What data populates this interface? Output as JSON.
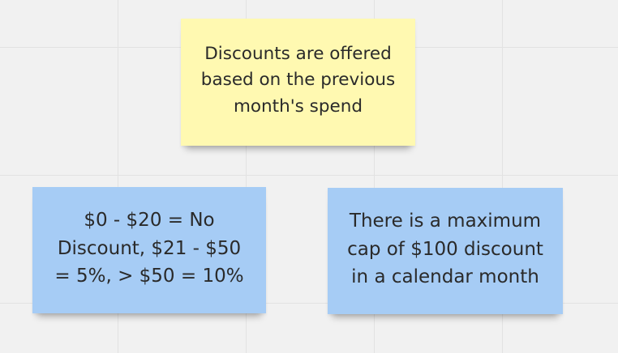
{
  "board": {
    "colors": {
      "background": "#f1f1f1",
      "grid_line": "#e2e2e2",
      "sticky_yellow": "#fff9b1",
      "sticky_blue": "#a6ccf5",
      "text": "#2a2a2a"
    }
  },
  "stickies": {
    "top": {
      "color": "yellow",
      "text": "Discounts are offered\nbased on the previous\nmonth's spend"
    },
    "left": {
      "color": "blue",
      "text": "$0 - $20 = No\nDiscount, $21 - $50\n= 5%, > $50 = 10%"
    },
    "right": {
      "color": "blue",
      "text": "There is a maximum\ncap of $100 discount\nin a calendar month"
    }
  }
}
